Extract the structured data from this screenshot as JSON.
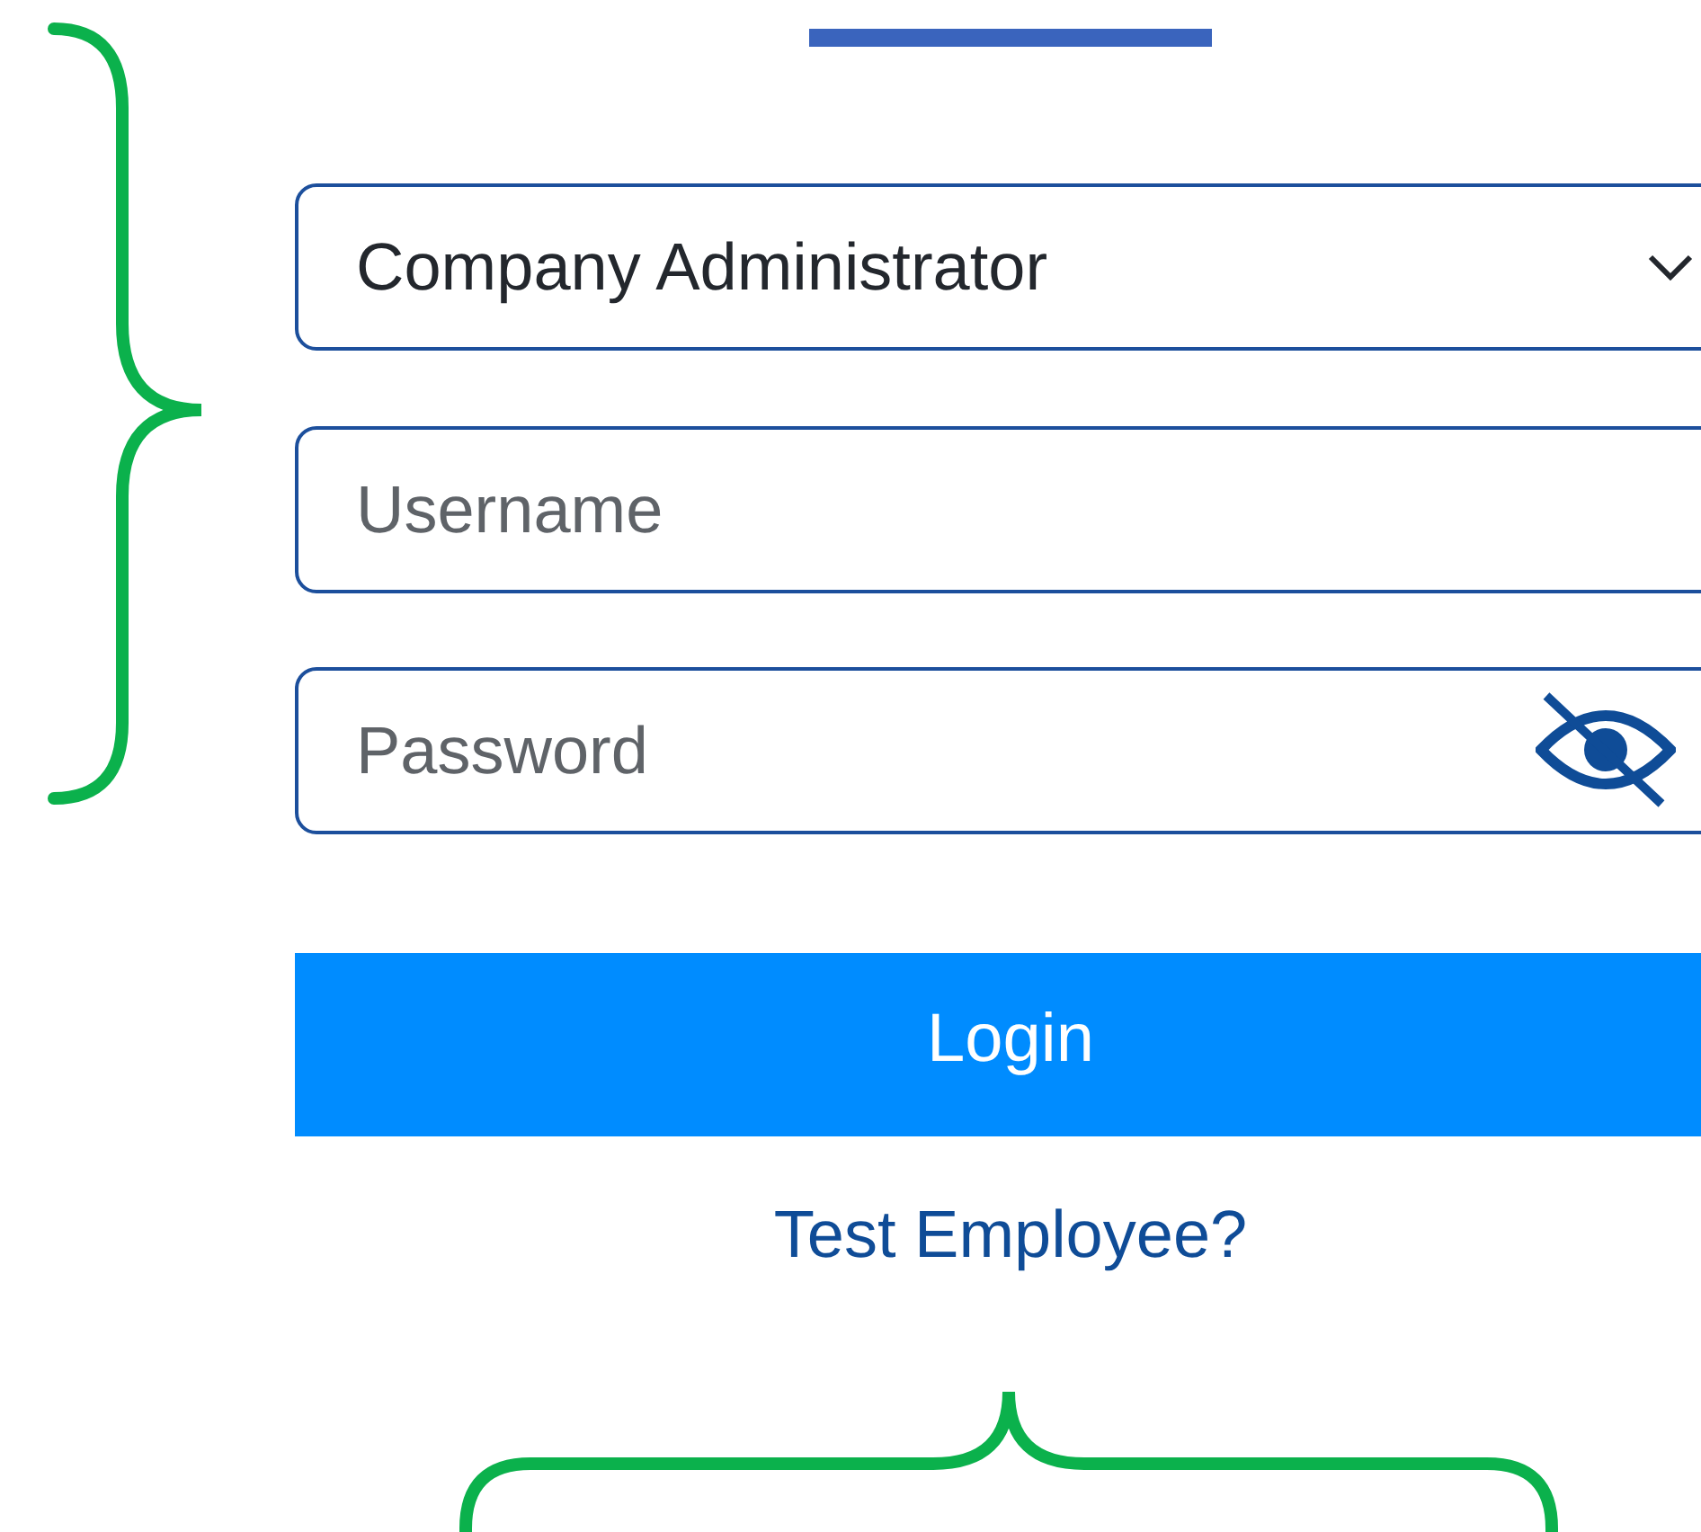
{
  "role_select": {
    "value": "Company Administrator"
  },
  "username": {
    "placeholder": "Username"
  },
  "password": {
    "placeholder": "Password",
    "masked": true
  },
  "login_button": {
    "label": "Login"
  },
  "test_employee_link": {
    "label": "Test Employee?"
  }
}
